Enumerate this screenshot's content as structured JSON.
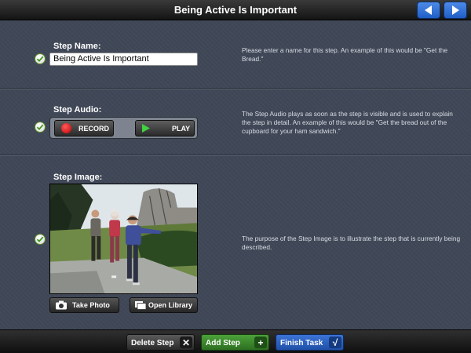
{
  "header": {
    "title": "Being Active Is Important",
    "back_icon": "arrow-left-icon",
    "forward_icon": "arrow-right-icon",
    "accent_color": "#2f72d9"
  },
  "step_name": {
    "label": "Step Name:",
    "value": "Being Active Is Important",
    "help": "Please enter a name for this step.  An example of this would be \"Get the Bread.\""
  },
  "step_audio": {
    "label": "Step Audio:",
    "record_label": "RECORD",
    "play_label": "PLAY",
    "help": "The Step Audio plays as soon as the step is visible and is used to explain the step in detail.  An example of this would be \"Get the bread out of the cupboard for your ham sandwich.\""
  },
  "step_image": {
    "label": "Step Image:",
    "take_photo_label": "Take Photo",
    "open_library_label": "Open Library",
    "help": "The purpose of the Step Image is to illustrate the step that is currently being described."
  },
  "footer": {
    "delete_label": "Delete Step",
    "add_label": "Add Step",
    "finish_label": "Finish Task",
    "delete_icon": "x-icon",
    "add_icon": "plus-icon",
    "finish_icon": "checkmark-icon",
    "add_color": "#3f8a2e",
    "finish_color": "#2f62c8"
  }
}
